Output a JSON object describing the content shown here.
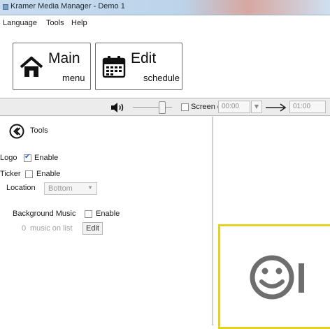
{
  "window": {
    "title": "Kramer Media Manager - Demo 1"
  },
  "menu": {
    "items": [
      "Language",
      "Tools",
      "Help"
    ]
  },
  "buttons": {
    "main": {
      "title": "Main",
      "subtitle": "menu"
    },
    "edit": {
      "title": "Edit",
      "subtitle": "schedule"
    }
  },
  "toolbar": {
    "volume_level": 0.8,
    "screen_off_label": "Screen off",
    "screen_off_checked": false,
    "start_time": "00:00",
    "end_time": "01:00"
  },
  "tools": {
    "header": "Tools",
    "logo": {
      "label": "Logo",
      "enable_label": "Enable",
      "checked": true
    },
    "ticker": {
      "label": "Ticker",
      "enable_label": "Enable",
      "checked": false,
      "location_label": "Location",
      "location_value": "Bottom"
    },
    "background_music": {
      "label": "Background Music",
      "enable_label": "Enable",
      "checked": false,
      "count": "0",
      "count_label": "music on list",
      "edit_label": "Edit"
    }
  },
  "colors": {
    "preview_border": "#e4d21c",
    "accent": "#1e5cc8"
  }
}
